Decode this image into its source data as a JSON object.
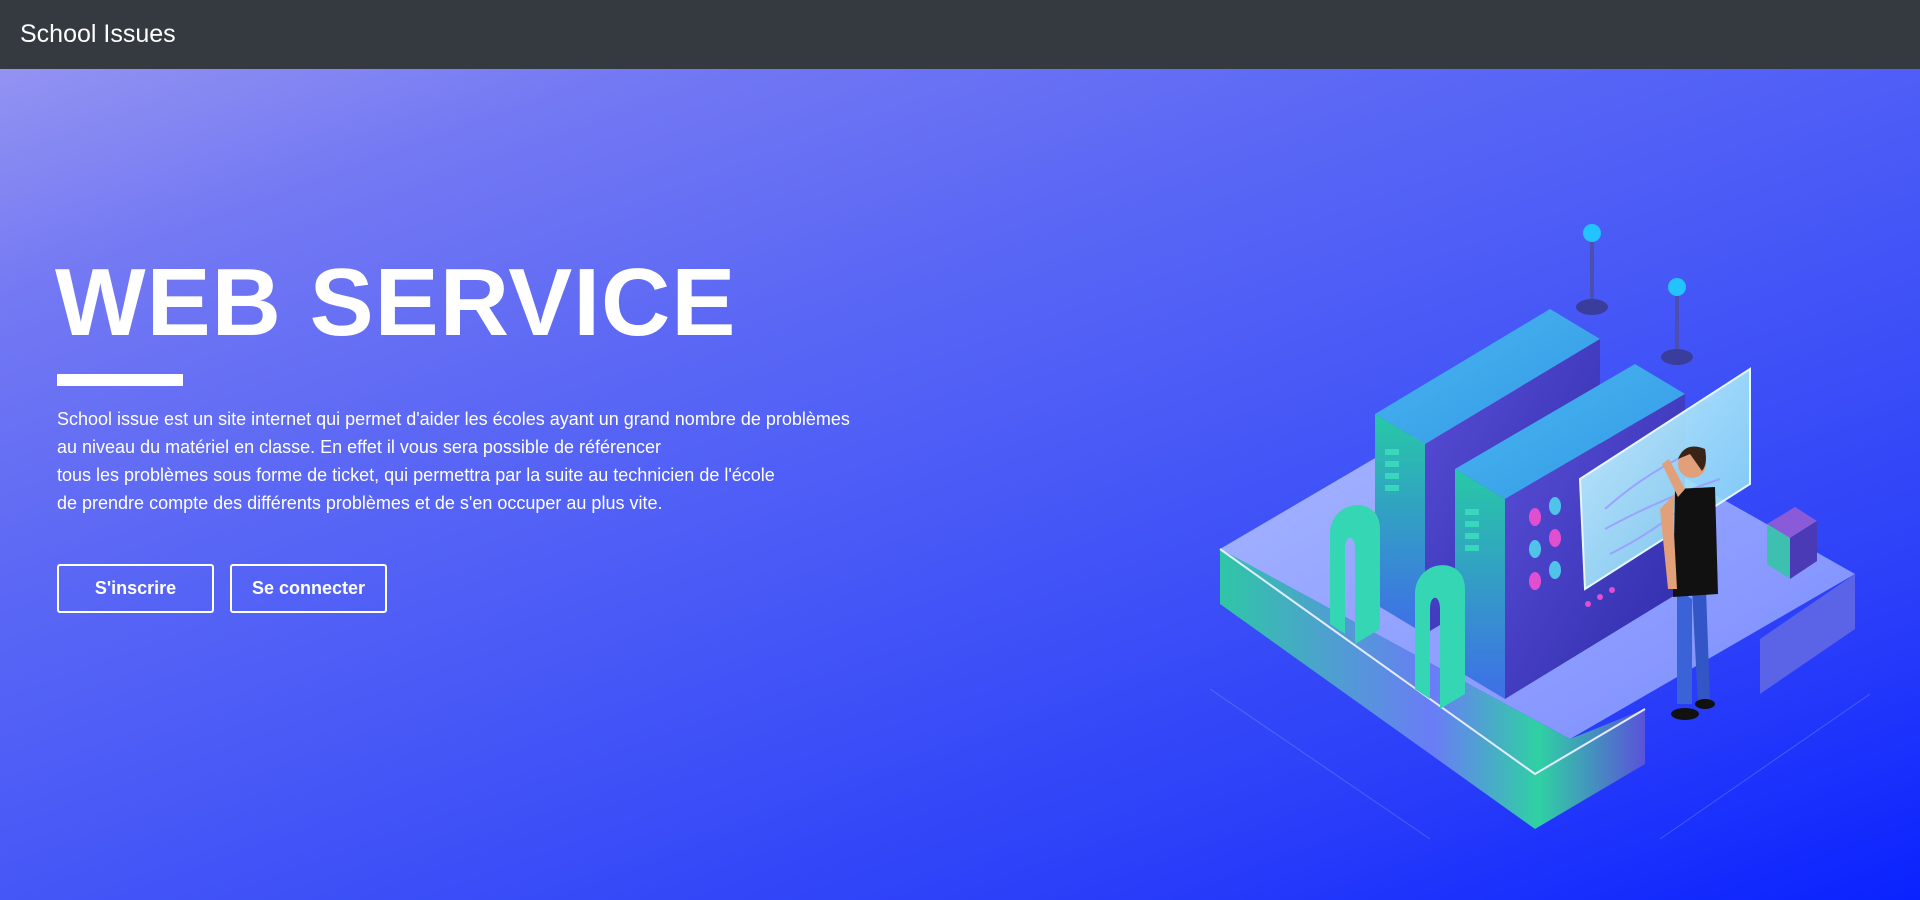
{
  "navbar": {
    "brand": "School Issues"
  },
  "hero": {
    "title": "WEB SERVICE",
    "description_lines": [
      "School issue est un site internet qui permet d'aider les écoles ayant un grand nombre de problèmes",
      "au niveau du matériel en classe. En effet il vous sera possible de référencer",
      "tous les problèmes sous forme de ticket, qui permettra par la suite au technicien de l'école",
      "de prendre compte des différents problèmes et de s'en occuper au plus vite."
    ],
    "buttons": {
      "register": "S'inscrire",
      "login": "Se connecter"
    }
  },
  "colors": {
    "navbar": "#343a40",
    "gradient_start": "#9393f2",
    "gradient_end": "#0a22ff",
    "text": "#ffffff"
  },
  "illustration": {
    "name": "isometric-server-room-illustration"
  }
}
